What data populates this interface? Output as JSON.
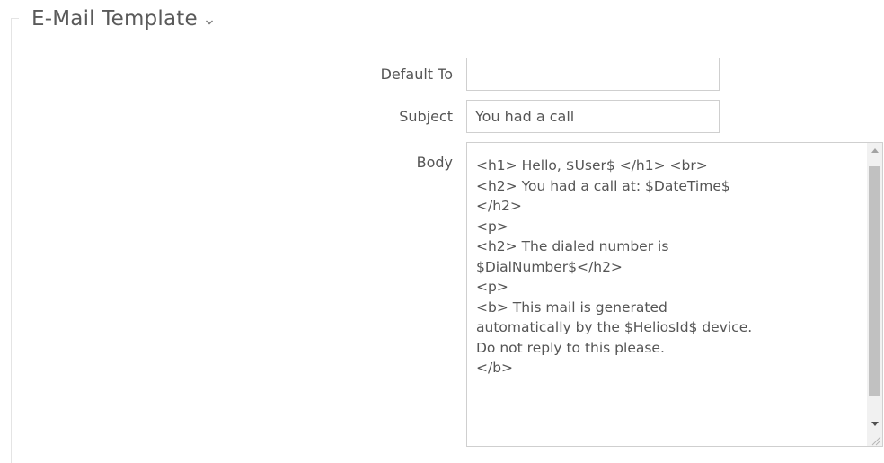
{
  "section": {
    "title": "E-Mail Template",
    "chevron_icon": "chevron-down-icon"
  },
  "form": {
    "default_to": {
      "label": "Default To",
      "value": ""
    },
    "subject": {
      "label": "Subject",
      "value": "You had a call"
    },
    "body": {
      "label": "Body",
      "value": "<h1> Hello, $User$ </h1> <br>\n<h2> You had a call at: $DateTime$\n</h2>\n<p>\n<h2> The dialed number is\n$DialNumber$</h2>\n<p>\n<b> This mail is generated\nautomatically by the $HeliosId$ device.\nDo not reply to this please.\n</b>"
    }
  },
  "scrollbar": {
    "up_icon": "scroll-up-arrow-icon",
    "down_icon": "scroll-down-arrow-icon",
    "resize_icon": "resize-grip-icon"
  }
}
